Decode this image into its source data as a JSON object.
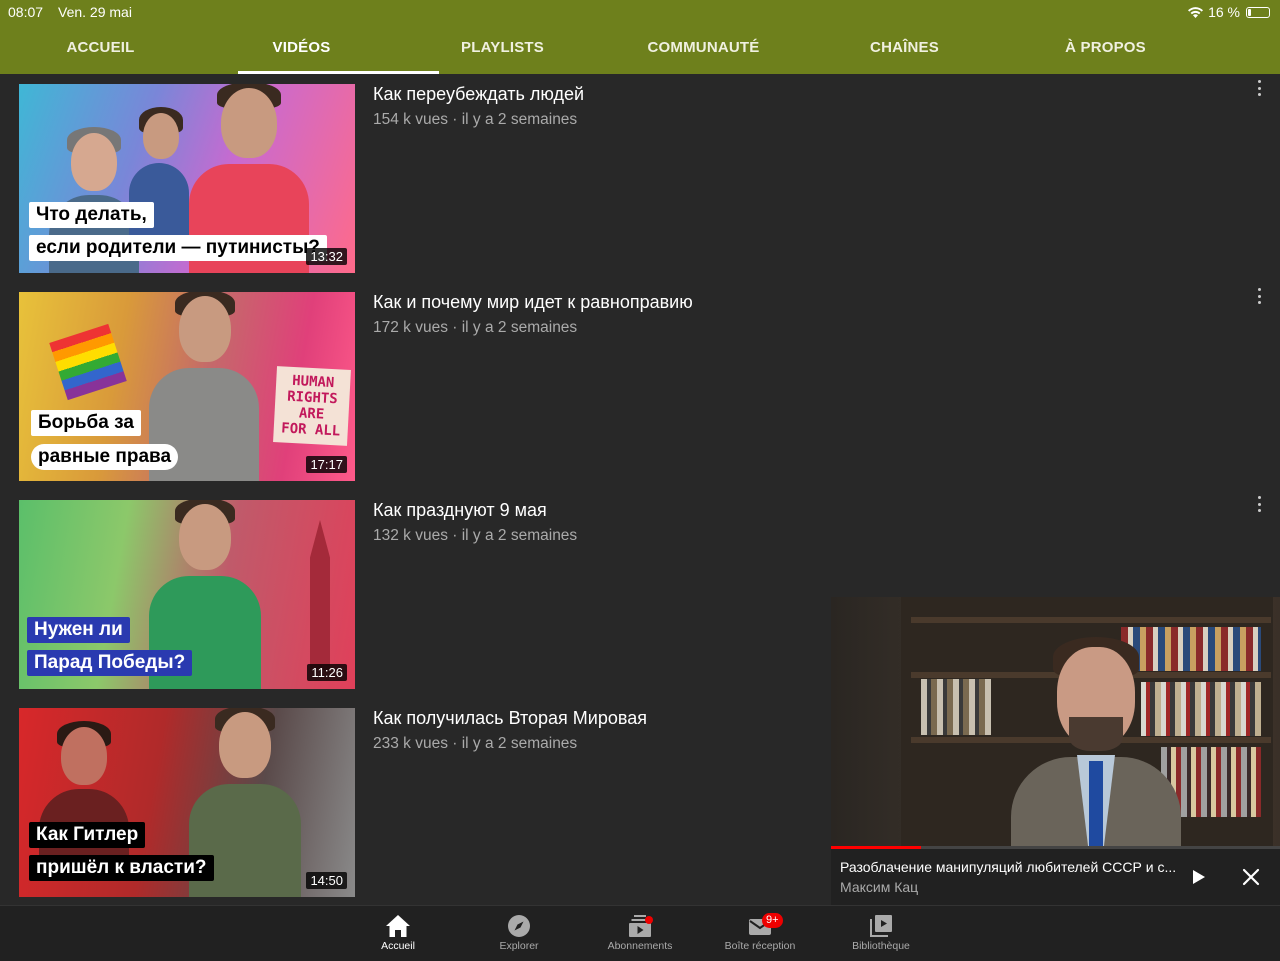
{
  "status": {
    "time": "08:07",
    "date": "Ven. 29 mai",
    "battery": "16 %",
    "battery_level": 0.16
  },
  "tabs": [
    {
      "label": "ACCUEIL"
    },
    {
      "label": "VIDÉOS",
      "active": true
    },
    {
      "label": "PLAYLISTS"
    },
    {
      "label": "COMMUNAUTÉ"
    },
    {
      "label": "CHAÎNES"
    },
    {
      "label": "À PROPOS"
    }
  ],
  "videos": [
    {
      "title": "Как переубеждать людей",
      "meta": "154 k vues · il y a 2 semaines",
      "duration": "13:32",
      "caption1": "Что делать,",
      "caption2": "если родители — путинисты?"
    },
    {
      "title": "Как и почему мир идет к равноправию",
      "meta": "172 k vues · il y a 2 semaines",
      "duration": "17:17",
      "caption1": "Борьба за",
      "caption2": "равные права"
    },
    {
      "title": "Как празднуют 9 мая",
      "meta": "132 k vues · il y a 2 semaines",
      "duration": "11:26",
      "caption1": "Нужен ли",
      "caption2": "Парад Победы?"
    },
    {
      "title": "Как получилась Вторая Мировая",
      "meta": "233 k vues · il y a 2 semaines",
      "duration": "14:50",
      "caption1": "Как Гитлер",
      "caption2": "пришёл к власти?"
    }
  ],
  "mini_player": {
    "title": "Разоблачение манипуляций любителей СССР и с...",
    "channel": "Максим Кац",
    "progress": 0.2
  },
  "bottom_nav": [
    {
      "label": "Accueil",
      "icon": "home-icon",
      "active": true
    },
    {
      "label": "Explorer",
      "icon": "compass-icon"
    },
    {
      "label": "Abonnements",
      "icon": "subscriptions-icon"
    },
    {
      "label": "Boîte réception",
      "icon": "inbox-icon",
      "badge": "9+"
    },
    {
      "label": "Bibliothèque",
      "icon": "library-icon"
    }
  ],
  "colors": {
    "brand": "#6e801c",
    "background": "#282828",
    "accent_red": "#ff0000"
  }
}
